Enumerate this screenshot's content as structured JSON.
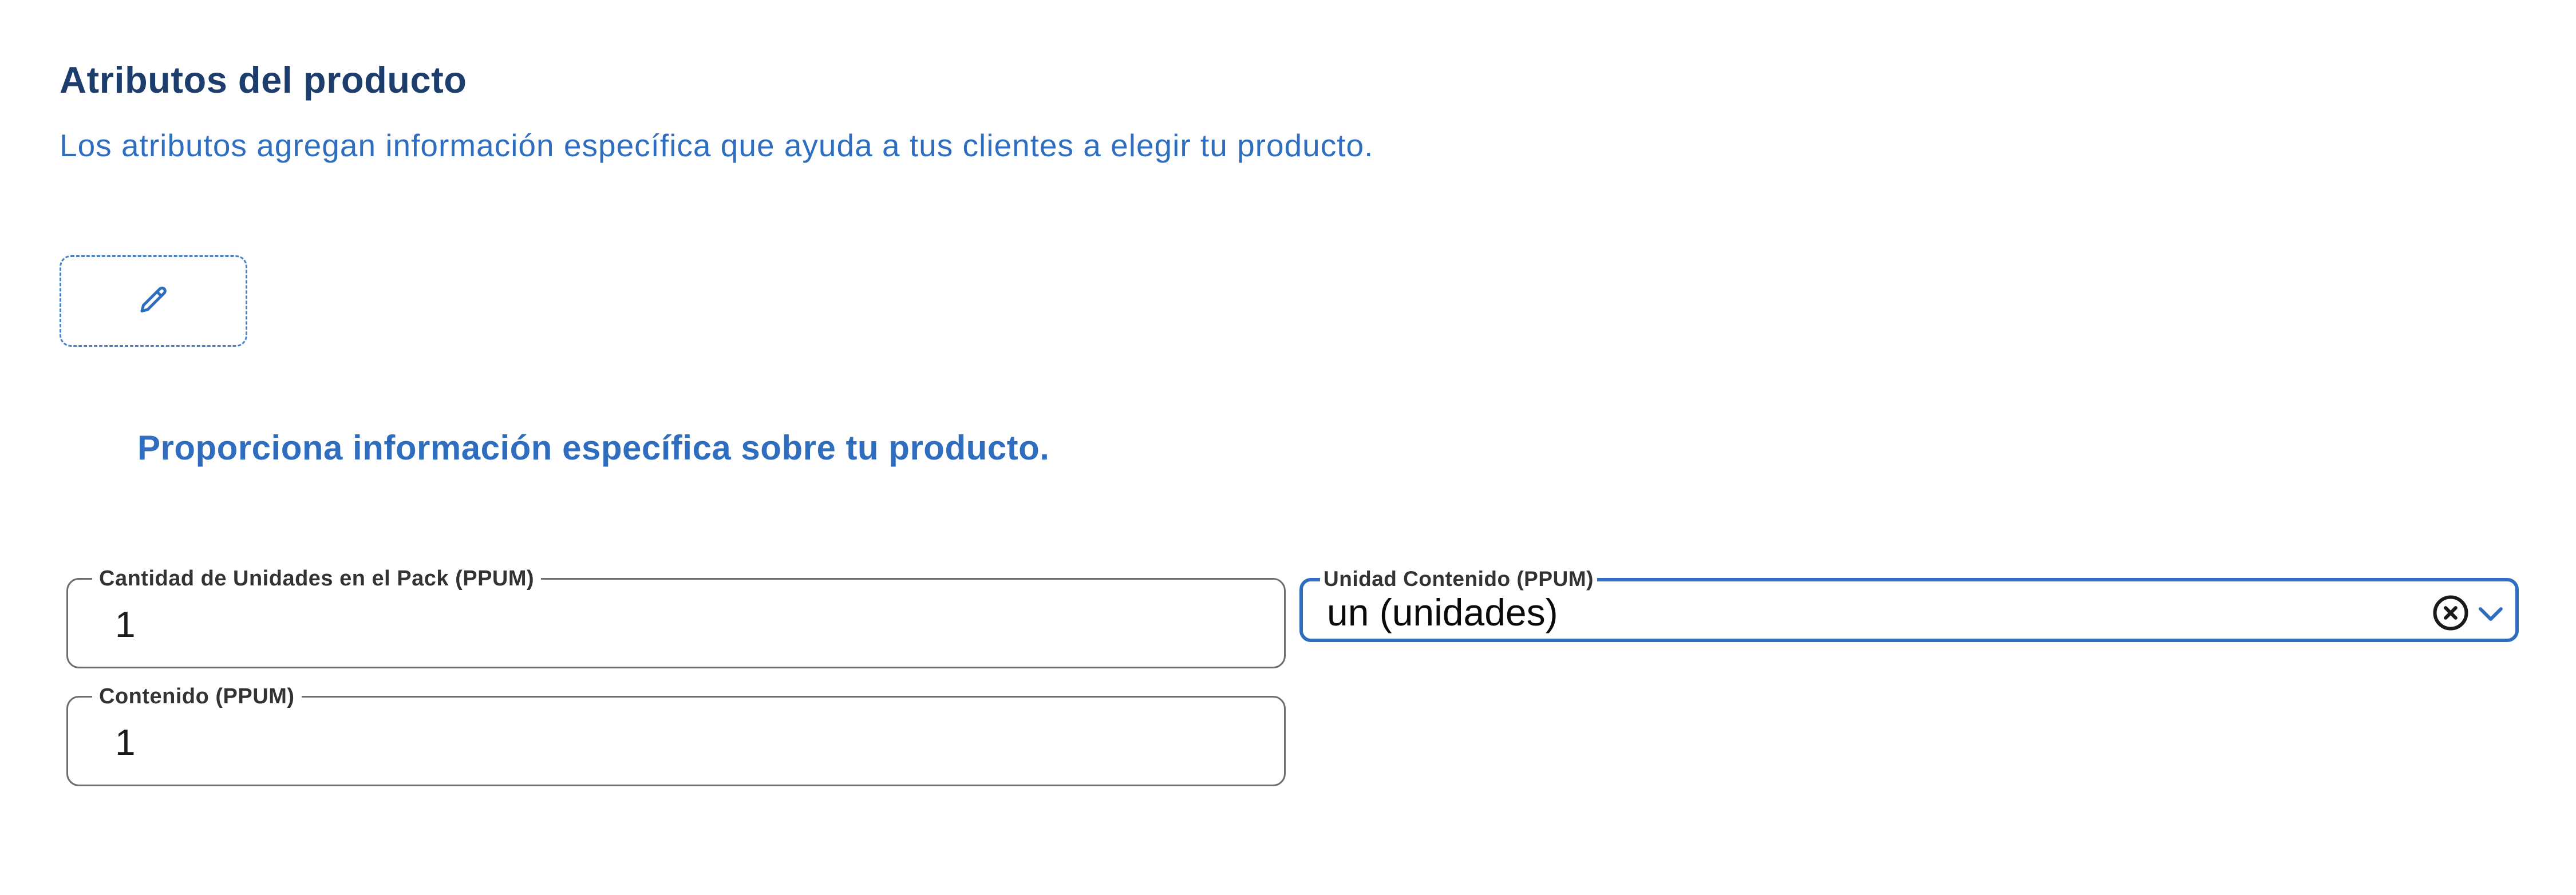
{
  "section": {
    "title": "Atributos del producto",
    "description": "Los atributos agregan información específica que ayuda a tus clientes a elegir tu producto."
  },
  "edit_button": {
    "icon": "pencil-icon"
  },
  "info_text": "Proporciona información específica sobre tu producto.",
  "fields": {
    "units_in_pack": {
      "label": "Cantidad de Unidades en el Pack (PPUM)",
      "value": "1"
    },
    "content": {
      "label": "Contenido (PPUM)",
      "value": "1"
    },
    "content_unit": {
      "label": "Unidad Contenido (PPUM)",
      "value": "un (unidades)",
      "clear_icon": "clear-circle-icon",
      "dropdown_icon": "chevron-down-icon"
    }
  },
  "colors": {
    "title": "#1d3e6c",
    "accent": "#2f6ebf",
    "field_border": "#6d6d6d",
    "focused_border": "#2f6ebf"
  }
}
